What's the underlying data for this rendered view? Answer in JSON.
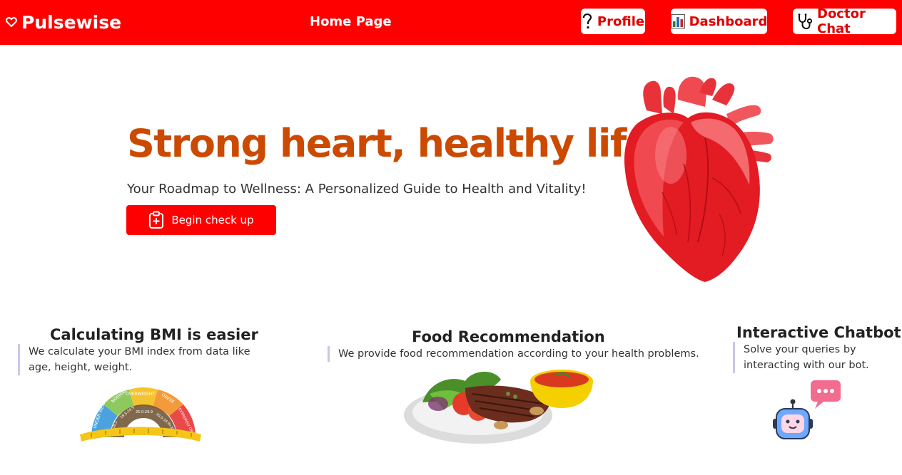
{
  "nav": {
    "brand": "Pulsewise",
    "home": "Home Page",
    "profile": "Profile",
    "dashboard": "Dashboard",
    "doctor_chat": "Doctor Chat"
  },
  "hero": {
    "title": "Strong heart, healthy life",
    "subtitle": "Your Roadmap to Wellness: A Personalized Guide to Health and Vitality!",
    "cta": "Begin check up"
  },
  "features": [
    {
      "title": "Calculating BMI is easier",
      "description": "We calculate your BMI index from data like age, height, weight.",
      "gauge": {
        "segments": [
          "UNDER WEIGHT",
          "NORMAL",
          "OVERWEIGHT",
          "OBESE",
          "EXTREMELY OBESE"
        ],
        "ranges": [
          "<18.5",
          "18.5-24.9",
          "25.0-29.9",
          "30.0-34.9",
          ">35.0"
        ]
      }
    },
    {
      "title": "Food Recommendation",
      "description": "We provide food recommendation according to your health problems."
    },
    {
      "title": "Interactive Chatbot",
      "description": "Solve your queries by interacting with our bot."
    }
  ],
  "colors": {
    "navbar": "#ff0000",
    "accent_text": "#cc4a00",
    "button": "#ff0000"
  }
}
